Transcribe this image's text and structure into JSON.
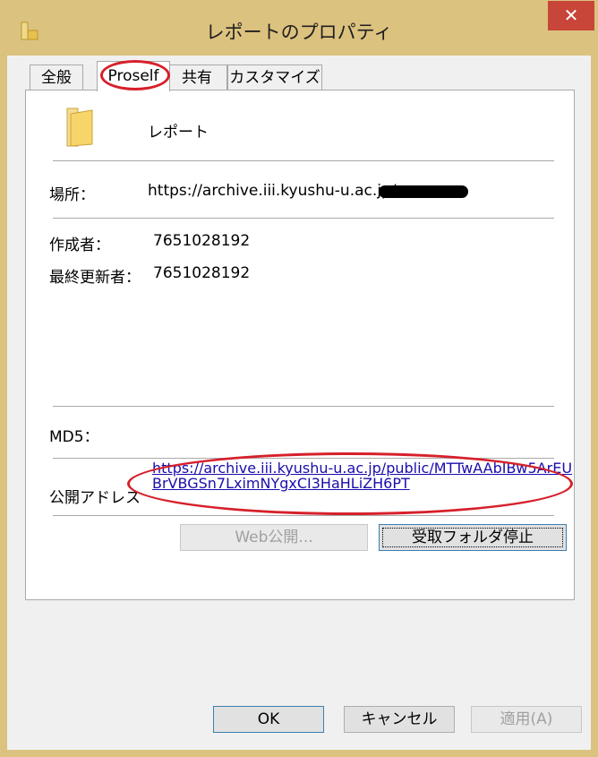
{
  "window": {
    "title": "レポートのプロパティ",
    "close_glyph": "✕"
  },
  "tabs": [
    {
      "label": "全般"
    },
    {
      "label": "Proself"
    },
    {
      "label": "共有"
    },
    {
      "label": "カスタマイズ"
    }
  ],
  "folder": {
    "name": "レポート"
  },
  "fields": {
    "location_label": "場所：",
    "location_value": "https://archive.iii.kyushu-u.ac.jp/",
    "creator_label": "作成者：",
    "creator_value": "7651028192",
    "modifier_label": "最終更新者：",
    "modifier_value": "7651028192",
    "md5_label": "MD5：",
    "public_address_label": "公開アドレス",
    "public_address_value": "https://archive.iii.kyushu-u.ac.jp/public/MTTwAAbIBw5ArEUBrVBGSn7LximNYgxCI3HaHLiZH6PT"
  },
  "buttons": {
    "web_publish": "Web公開...",
    "stop_receive_folder": "受取フォルダ停止",
    "ok": "OK",
    "cancel": "キャンセル",
    "apply": "適用(A)"
  },
  "colors": {
    "accent": "#dcc27f",
    "highlight": "#d6202b",
    "link": "#1a0dab",
    "close": "#c74539"
  }
}
